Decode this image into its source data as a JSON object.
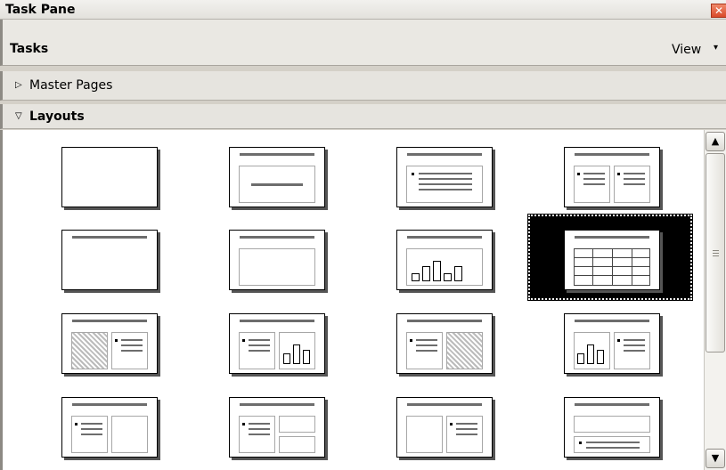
{
  "window": {
    "title": "Task Pane",
    "close_label": "✕"
  },
  "header": {
    "title": "Tasks",
    "view_label": "View",
    "view_arrow": "▾"
  },
  "sections": {
    "master_pages": {
      "label": "Master Pages",
      "arrow": "▷"
    },
    "layouts": {
      "label": "Layouts",
      "arrow": "▽"
    }
  },
  "scrollbar": {
    "up": "▲",
    "down": "▼"
  },
  "layouts": {
    "selected": "title-table",
    "items": [
      "blank",
      "title-only",
      "title-content",
      "title-2-content",
      "title-only-top",
      "centered-text",
      "title-chart",
      "title-table",
      "title-clipart-text",
      "title-text-chart",
      "title-text-clipart",
      "title-chart-text",
      "title-text-box",
      "title-text-2-boxes",
      "title-box-text",
      "title-text-bottom"
    ]
  }
}
